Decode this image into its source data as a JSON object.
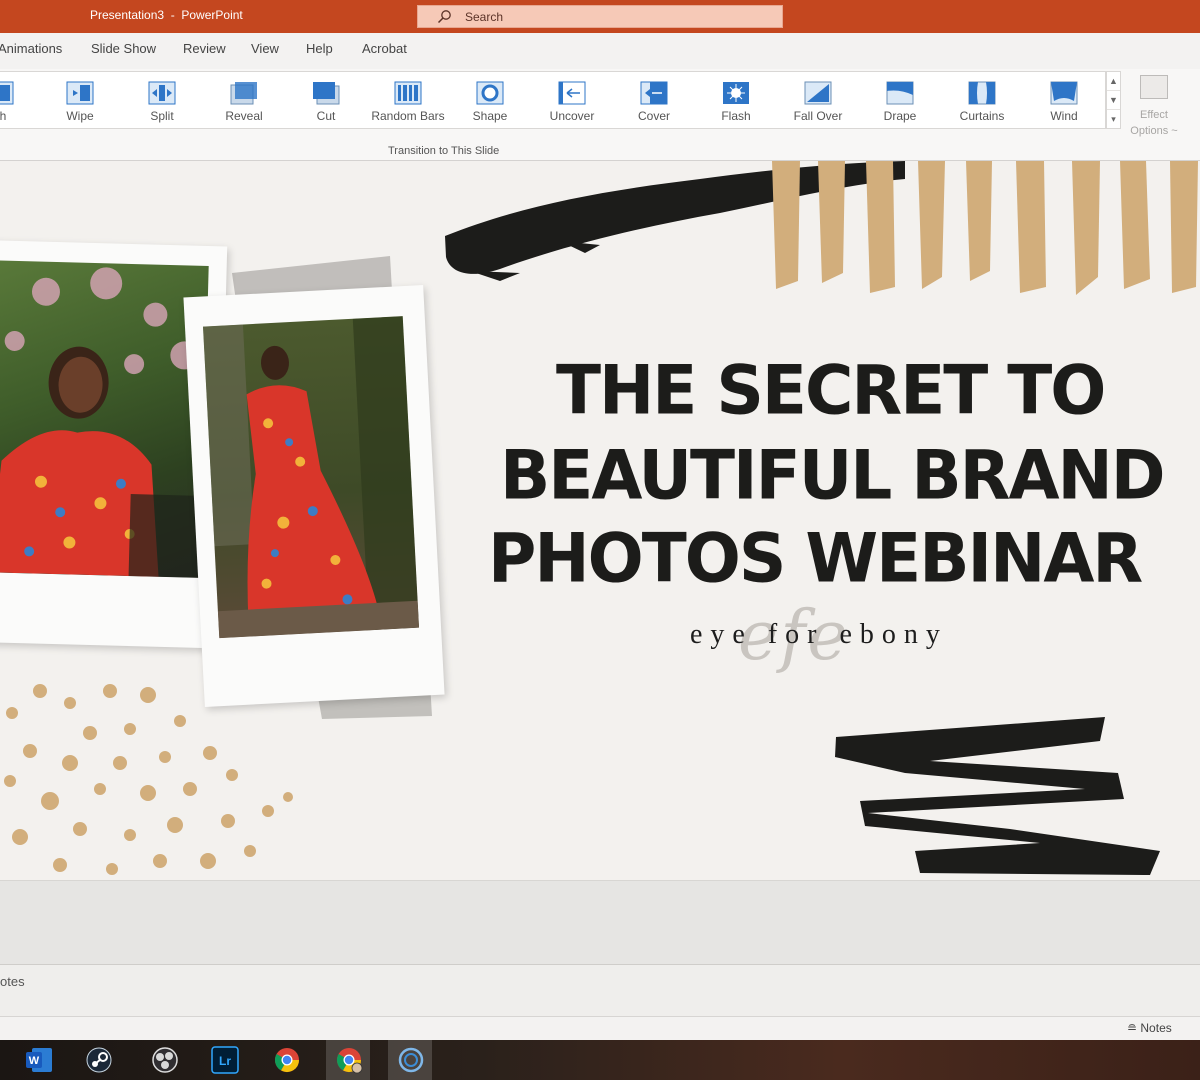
{
  "titlebar": {
    "title": "Presentation3  -  PowerPoint",
    "search_placeholder": "Search",
    "search_icon": "search-icon"
  },
  "menu": {
    "tabs": [
      "Animations",
      "Slide Show",
      "Review",
      "View",
      "Help",
      "Acrobat"
    ]
  },
  "ribbon": {
    "transitions": [
      {
        "label": "sh",
        "icon": "flash-transition-icon"
      },
      {
        "label": "Wipe",
        "icon": "wipe-icon"
      },
      {
        "label": "Split",
        "icon": "split-icon"
      },
      {
        "label": "Reveal",
        "icon": "reveal-icon"
      },
      {
        "label": "Cut",
        "icon": "cut-icon"
      },
      {
        "label": "Random Bars",
        "icon": "random-bars-icon"
      },
      {
        "label": "Shape",
        "icon": "shape-icon"
      },
      {
        "label": "Uncover",
        "icon": "uncover-icon"
      },
      {
        "label": "Cover",
        "icon": "cover-icon"
      },
      {
        "label": "Flash",
        "icon": "flash-icon"
      },
      {
        "label": "Fall Over",
        "icon": "fall-over-icon"
      },
      {
        "label": "Drape",
        "icon": "drape-icon"
      },
      {
        "label": "Curtains",
        "icon": "curtains-icon"
      },
      {
        "label": "Wind",
        "icon": "wind-icon"
      }
    ],
    "effect_options_line1": "Effect",
    "effect_options_line2": "Options ~",
    "group_label": "Transition to This Slide"
  },
  "slide": {
    "title_lines": [
      "THE SECRET TO",
      "BEAUTIFUL BRAND",
      "PHOTOS WEBINAR"
    ],
    "brand_text": "eye for ebony",
    "brand_mark": "efe",
    "colors": {
      "background": "#f3f1ee",
      "gold": "#d2ae7c",
      "black": "#1c1c1a",
      "dress": "#d9362a"
    }
  },
  "notes": {
    "placeholder": "otes"
  },
  "statusbar": {
    "notes_button": "Notes"
  },
  "taskbar": {
    "apps": [
      {
        "name": "word-icon"
      },
      {
        "name": "steam-icon"
      },
      {
        "name": "obs-icon"
      },
      {
        "name": "lightroom-icon"
      },
      {
        "name": "chrome-icon"
      },
      {
        "name": "chrome-profile-icon"
      },
      {
        "name": "cortana-icon"
      }
    ],
    "lightroom_label": "Lr",
    "word_label": "W"
  }
}
